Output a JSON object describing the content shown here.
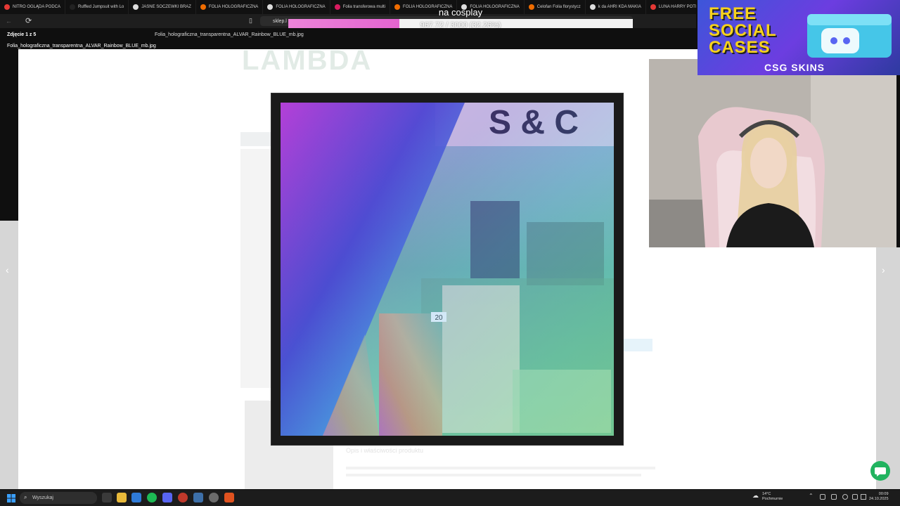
{
  "browser": {
    "tabs": [
      {
        "label": "NITRO OGLĄDA PODCA",
        "icon_color": "#e53935"
      },
      {
        "label": "Ruffled Jumpsuit with Lo",
        "icon_color": "#222222"
      },
      {
        "label": "JASNE SOCZEWKI BRAZ",
        "icon_color": "#dddddd"
      },
      {
        "label": "FOLIA HOLOGRAFICZNA",
        "icon_color": "#ef6c00"
      },
      {
        "label": "FOLIA HOLOGRAFICZNA",
        "icon_color": "#dddddd"
      },
      {
        "label": "Folia transferowa multi",
        "icon_color": "#d81b60"
      },
      {
        "label": "FOLIA HOLOGRAFICZNA",
        "icon_color": "#ef6c00"
      },
      {
        "label": "FOLIA HOLOGRAFICZNA",
        "icon_color": "#dddddd"
      },
      {
        "label": "Celofan Folia florystycz",
        "icon_color": "#ef6c00"
      },
      {
        "label": "k da AHRI KDA MAKIA",
        "icon_color": "#dddddd"
      },
      {
        "label": "LUNA HARRY POTER - B",
        "icon_color": "#e53935"
      }
    ],
    "address": "sklep.l"
  },
  "overlay": {
    "title": "na cosplay",
    "progress_text": "967.72 / 3000 (32.26%)",
    "progress_fraction": 0.3226
  },
  "lightbox": {
    "counter": "Zdjęcie 1 z 5",
    "filename_top": "Folia_holograficzna_transparentna_ALVAR_Rainbow_BLUE_mb.jpg",
    "filename_bottom": "Folia_holograficzna_transparentna_ALVAR_Rainbow_BLUE_mb.jpg",
    "prev_glyph": "‹",
    "next_glyph": "›"
  },
  "page": {
    "logo": "LAMBDA",
    "description_heading": "Opis i właściwości produktu"
  },
  "photo": {
    "sign_text": "S & C",
    "price_tag": "20"
  },
  "sponsor": {
    "line1": "FREE",
    "line2": "SOCIAL",
    "line3": "CASES",
    "brand": "CSG SKINS"
  },
  "taskbar": {
    "search_placeholder": "Wyszukaj",
    "weather_temp": "14°C",
    "weather_desc": "Pochmurnie",
    "time": "00:09",
    "date": "24.10.2025"
  },
  "colors": {
    "progress_fill": "#e364d0",
    "accent_chat": "#21b35f",
    "sponsor_yellow": "#f7d21c"
  }
}
